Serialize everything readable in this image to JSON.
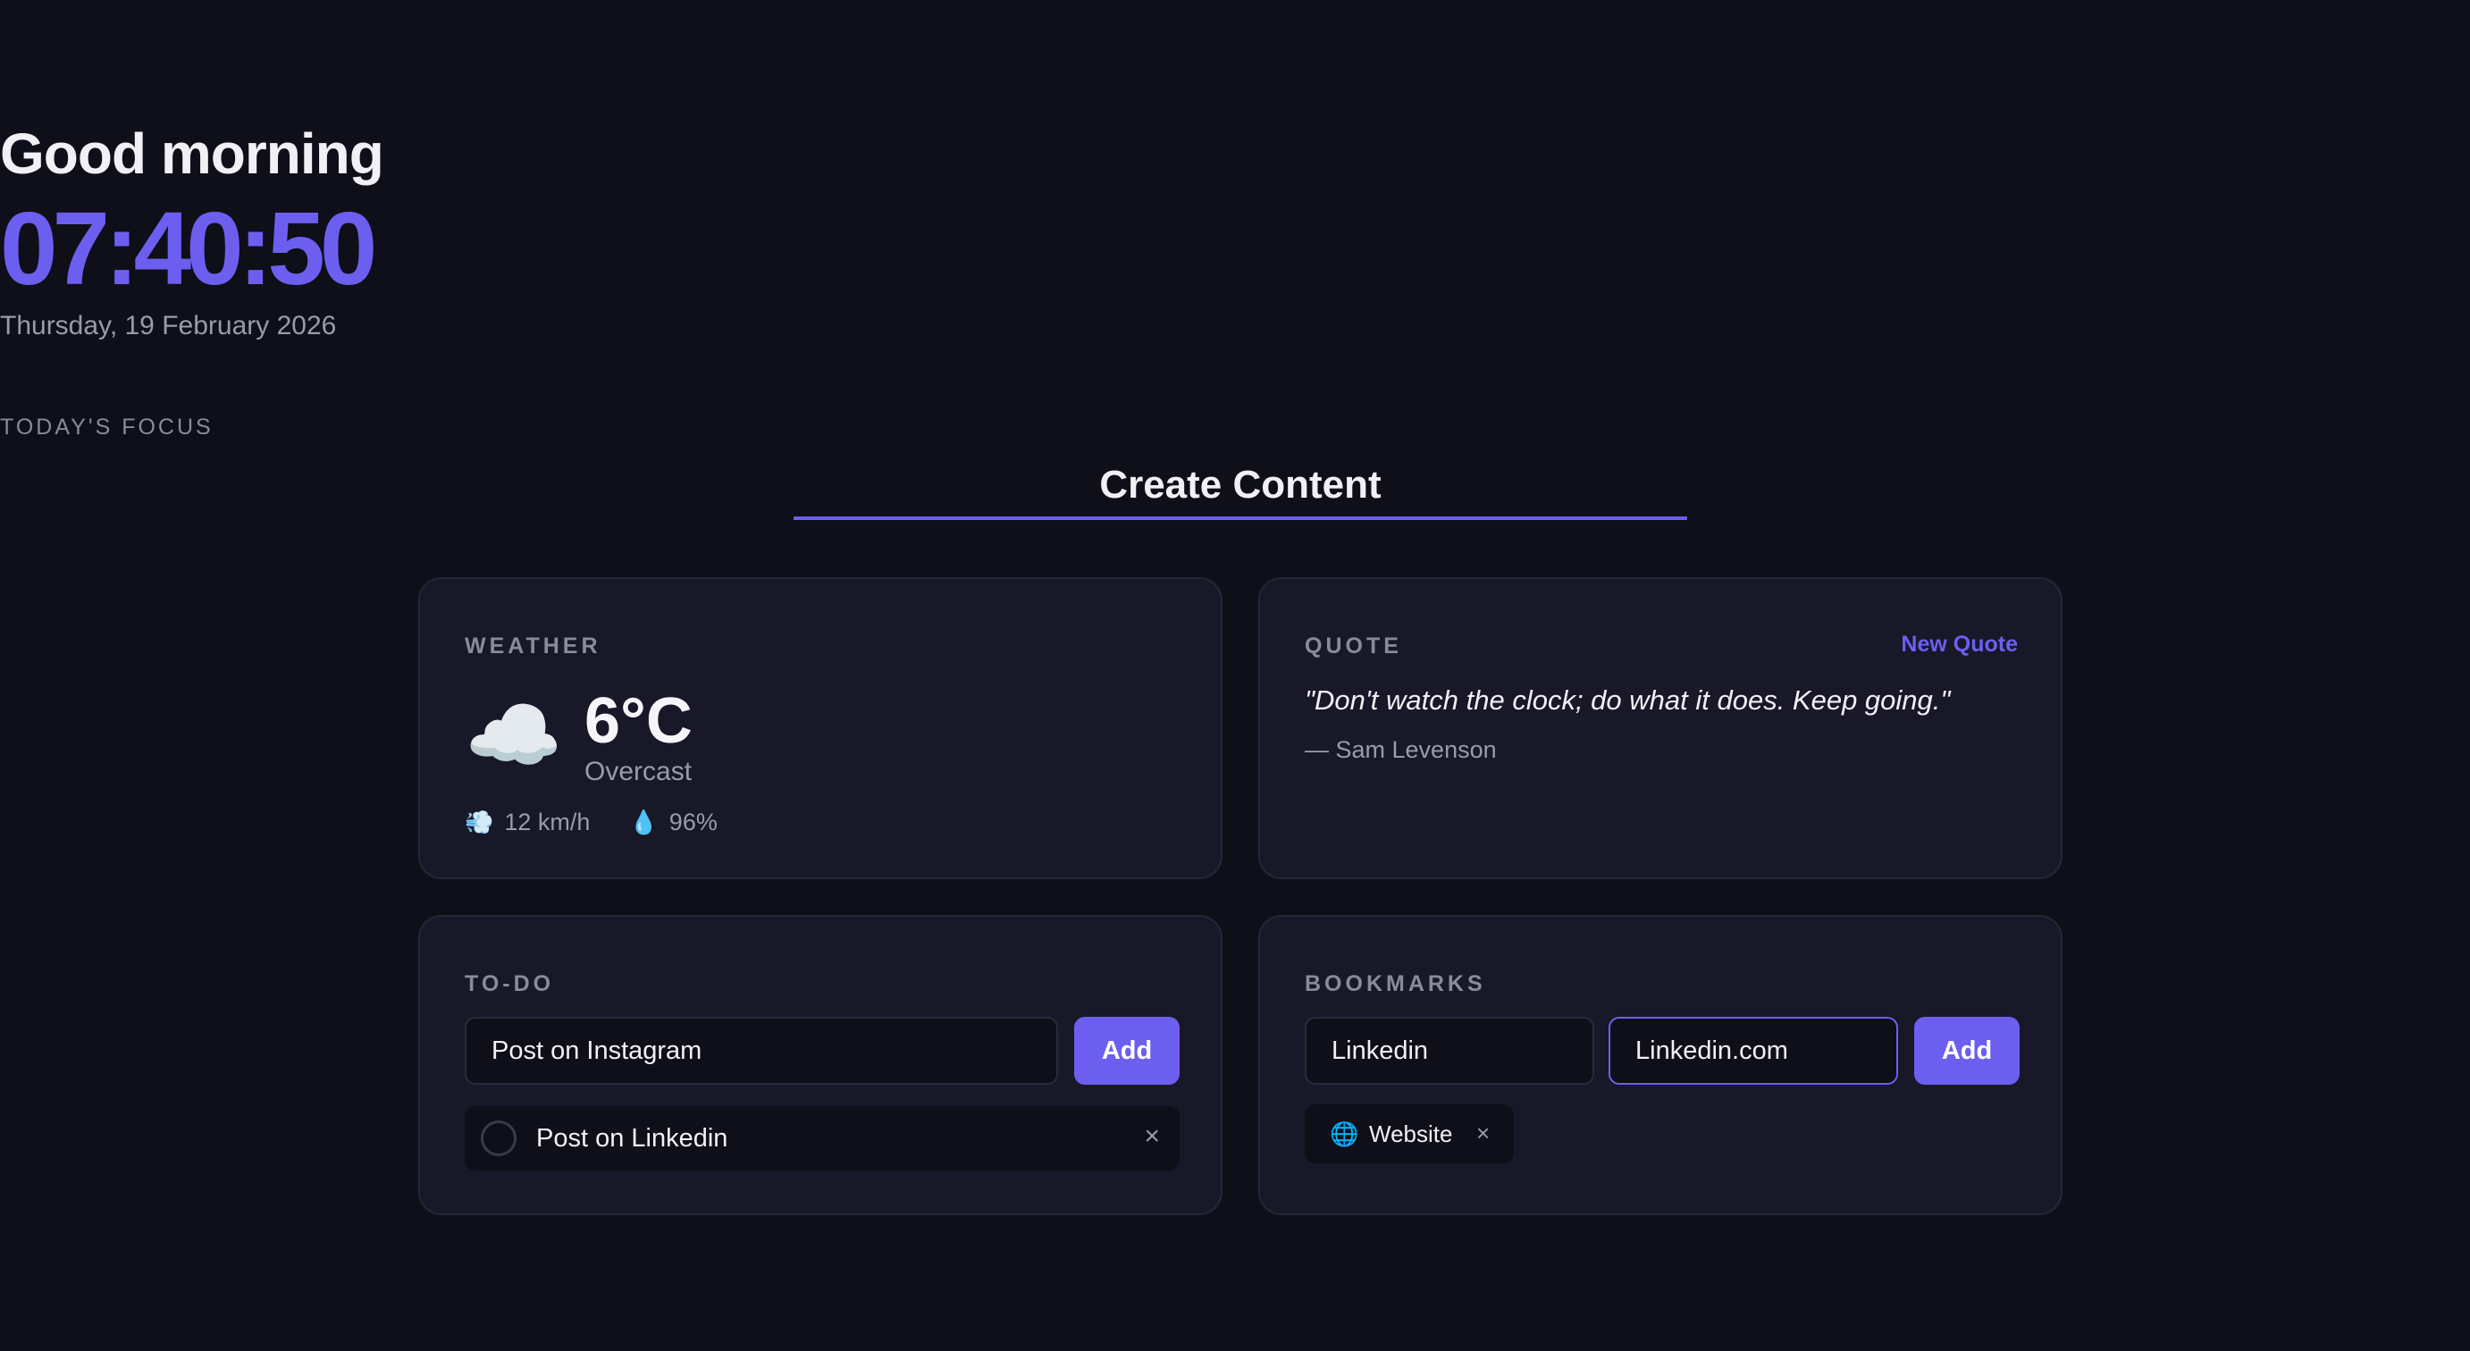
{
  "header": {
    "greeting": "Good morning",
    "clock": "07:40:50",
    "date": "Thursday, 19 February 2026"
  },
  "focus": {
    "label": "TODAY'S FOCUS",
    "value": "Create Content"
  },
  "weather": {
    "title": "WEATHER",
    "icon": "cloud-icon",
    "temperature": "6°C",
    "condition": "Overcast",
    "wind": "12 km/h",
    "humidity": "96%"
  },
  "quote": {
    "title": "QUOTE",
    "new_quote_label": "New Quote",
    "text": "\"Don't watch the clock; do what it does. Keep going.\"",
    "author": "— Sam Levenson"
  },
  "todo": {
    "title": "TO-DO",
    "input_value": "Post on Instagram",
    "add_label": "Add",
    "items": [
      {
        "text": "Post on Linkedin",
        "done": false
      }
    ]
  },
  "bookmarks": {
    "title": "BOOKMARKS",
    "name_input_value": "Linkedin",
    "url_input_value": "Linkedin.com",
    "add_label": "Add",
    "items": [
      {
        "label": "Website",
        "icon": "globe-icon"
      }
    ]
  },
  "colors": {
    "background": "#0f0f1a",
    "card": "#181828",
    "accent": "#6c5ff0",
    "muted": "#9a9aab"
  }
}
